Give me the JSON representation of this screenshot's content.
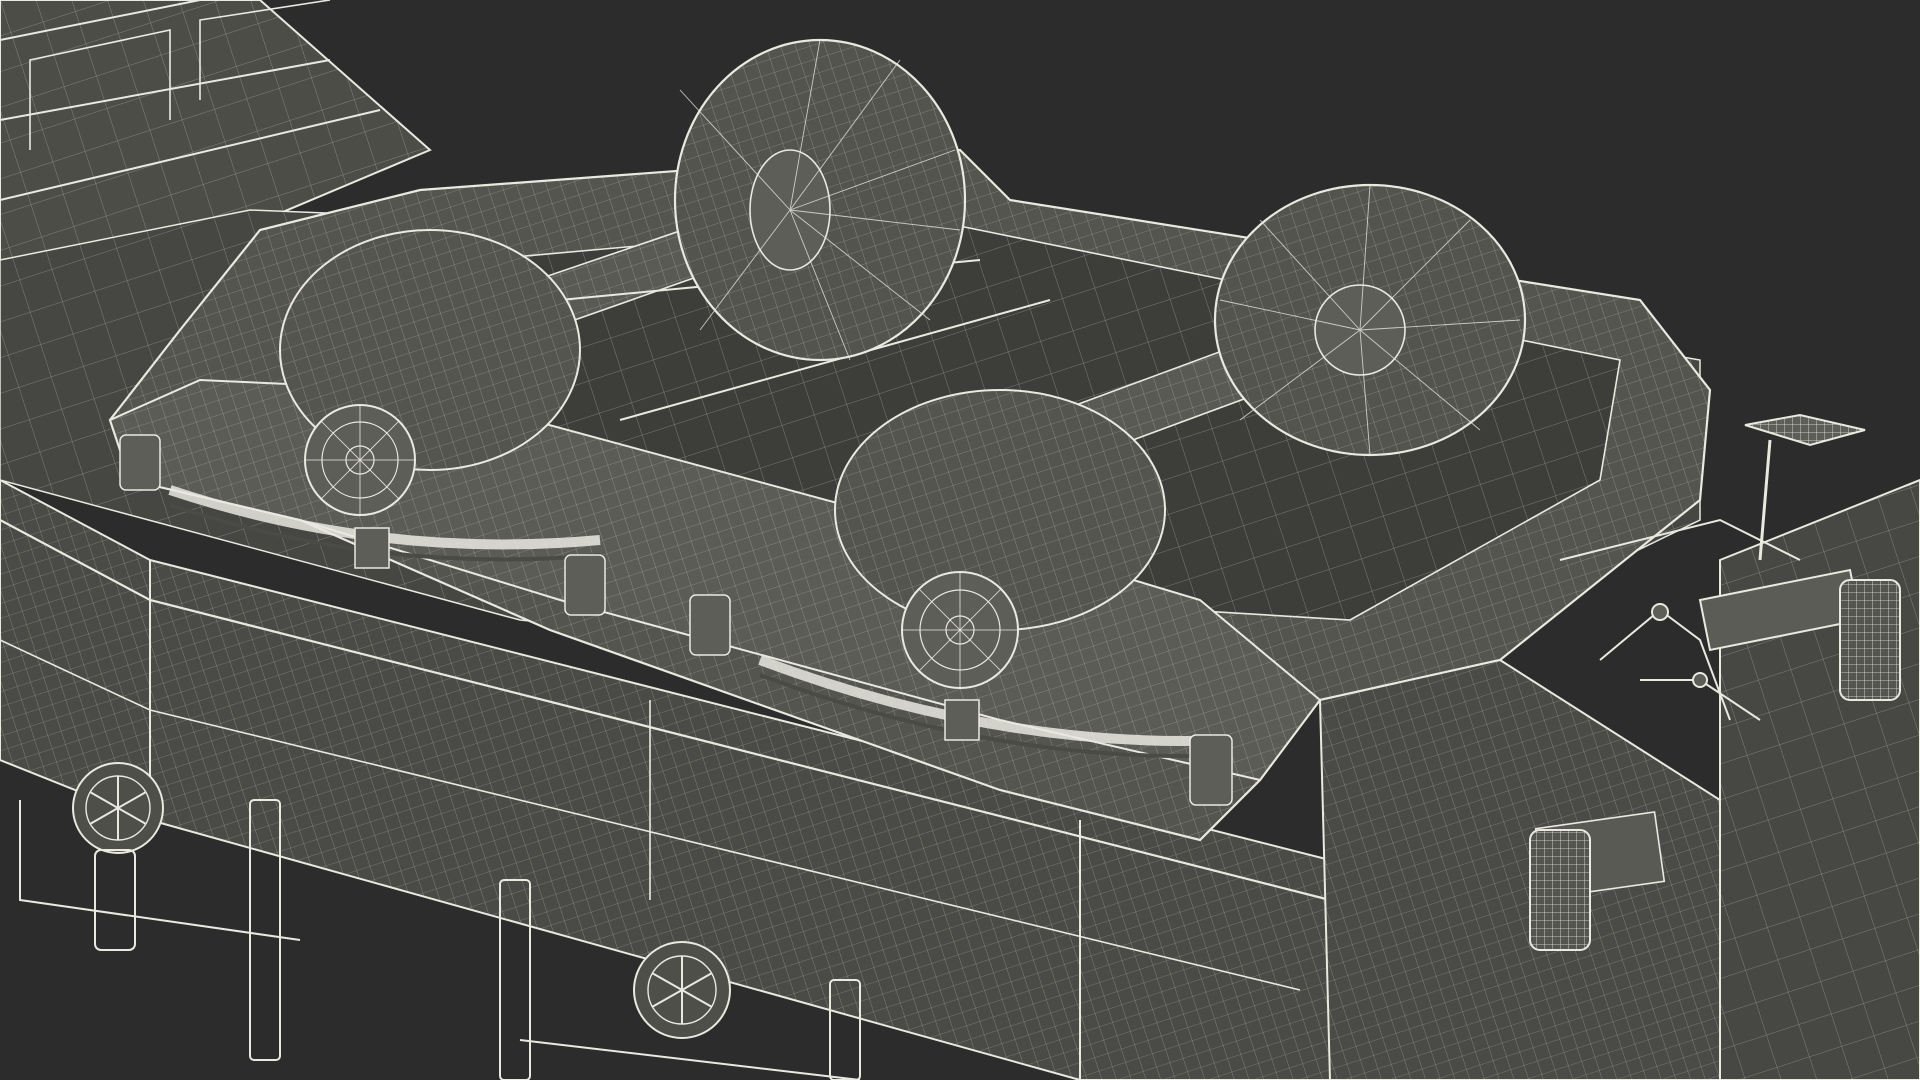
{
  "scene": {
    "subject": "wireframe-3d-hopper-railcar-bogie",
    "colors": {
      "background": "#2c2c2c",
      "surface": "#4a4a46",
      "surface_light": "#5a5a55",
      "surface_dark": "#3a3a37",
      "wire": "#e9e9e0",
      "wire_dim": "#b9b9b0"
    },
    "parts": [
      "car-body-deck",
      "side-sill-beam",
      "bogie-frame",
      "wheelset-front",
      "wheelset-rear",
      "axle-bearing-left",
      "axle-bearing-right",
      "leaf-spring",
      "hand-brake-wheel-left",
      "hand-brake-wheel-center",
      "end-platform-step",
      "coupler-buffer",
      "hopper-leg-left",
      "hopper-leg-center"
    ]
  }
}
